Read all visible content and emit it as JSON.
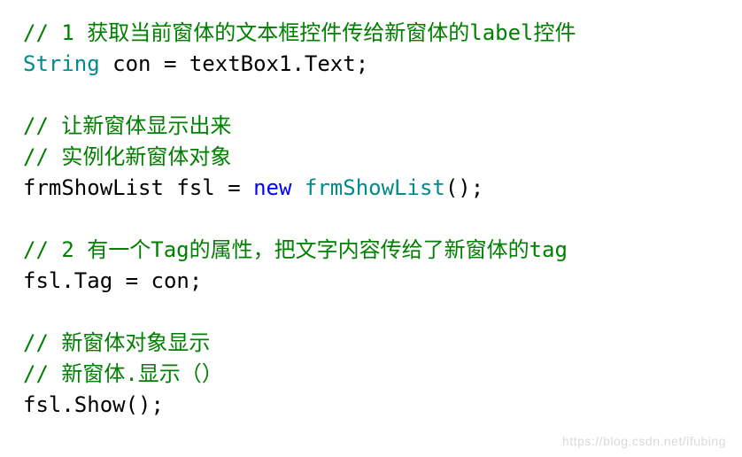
{
  "code": {
    "line1_comment": "// 1 获取当前窗体的文本框控件传给新窗体的label控件",
    "line2_type": "String",
    "line2_rest": " con = textBox1.Text;",
    "blank": "",
    "line4_comment": "// 让新窗体显示出来",
    "line5_comment": "// 实例化新窗体对象",
    "line6_a": "frmShowList fsl = ",
    "line6_kw": "new",
    "line6_sp": " ",
    "line6_type": "frmShowList",
    "line6_b": "();",
    "line8_comment": "// 2 有一个Tag的属性，把文字内容传给了新窗体的tag",
    "line9": "fsl.Tag = con;",
    "line11_comment": "// 新窗体对象显示",
    "line12_comment": "// 新窗体.显示（）",
    "line13": "fsl.Show();"
  },
  "watermark": "https://blog.csdn.net/ifubing"
}
